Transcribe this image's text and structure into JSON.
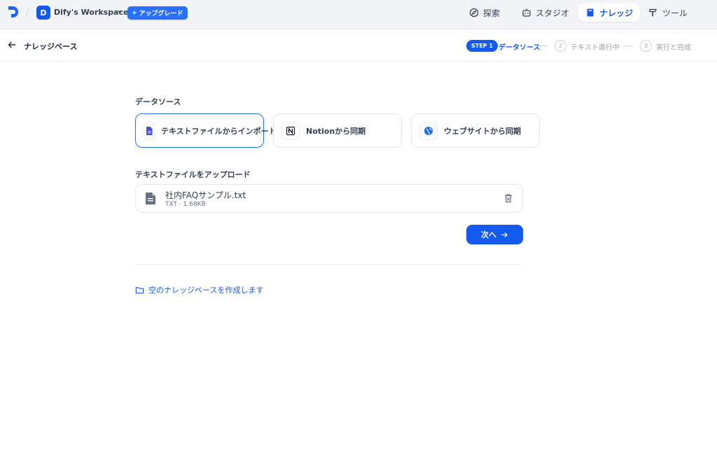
{
  "topbar": {
    "workspace_initial": "D",
    "workspace_name": "Dify's Workspace",
    "upgrade_label": "アップグレード",
    "nav": [
      {
        "label": "探索",
        "icon": "compass-icon",
        "active": false
      },
      {
        "label": "スタジオ",
        "icon": "robot-icon",
        "active": false
      },
      {
        "label": "ナレッジ",
        "icon": "book-icon",
        "active": true
      },
      {
        "label": "ツール",
        "icon": "hammer-icon",
        "active": false
      }
    ]
  },
  "subheader": {
    "title": "ナレッジベース",
    "steps": [
      {
        "badge": "STEP 1",
        "label": "データソース",
        "active": true
      },
      {
        "num": "2",
        "label": "テキスト進行中",
        "active": false
      },
      {
        "num": "3",
        "label": "実行と完成",
        "active": false
      }
    ]
  },
  "main": {
    "datasource_title": "データソース",
    "sources": [
      {
        "label": "テキストファイルからインポート",
        "icon": "document-icon",
        "selected": true
      },
      {
        "label": "Notionから同期",
        "icon": "notion-icon",
        "selected": false
      },
      {
        "label": "ウェブサイトから同期",
        "icon": "globe-icon",
        "selected": false
      }
    ],
    "upload_title": "テキストファイルをアップロード",
    "file": {
      "name": "社内FAQサンプル.txt",
      "type": "TXT",
      "separator": "·",
      "size": "1.68KB"
    },
    "next_label": "次へ",
    "create_empty_label": "空のナレッジベースを作成します"
  },
  "colors": {
    "accent": "#155aef",
    "upgrade": "#2970ff",
    "topbar_bg": "#f2f4f7"
  }
}
